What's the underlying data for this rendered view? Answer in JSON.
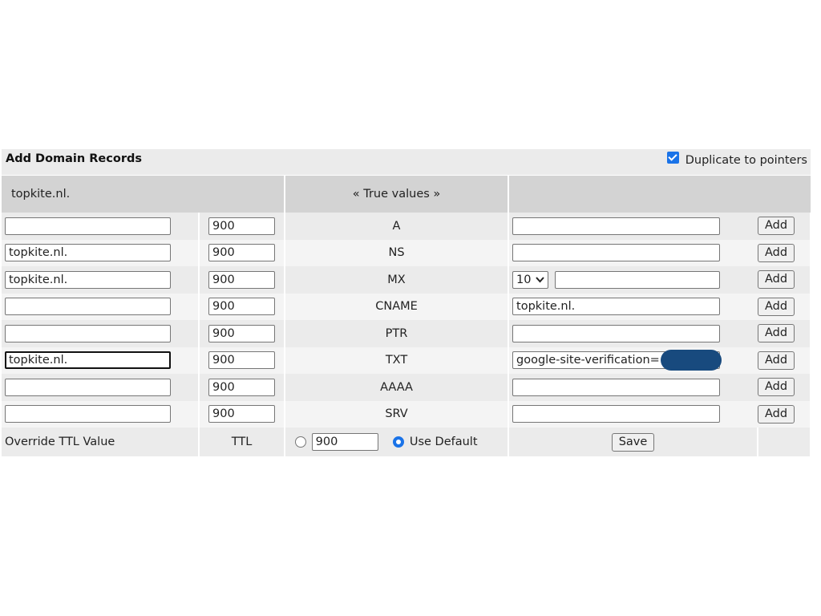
{
  "panel": {
    "title": "Add Domain Records",
    "duplicate_label": "Duplicate to pointers",
    "duplicate_checked": true
  },
  "header": {
    "domain": "topkite.nl.",
    "true_values": "« True values »"
  },
  "records": [
    {
      "name": "",
      "ttl": "900",
      "type": "A",
      "value": "",
      "add_label": "Add"
    },
    {
      "name": "topkite.nl.",
      "ttl": "900",
      "type": "NS",
      "value": "",
      "add_label": "Add"
    },
    {
      "name": "topkite.nl.",
      "ttl": "900",
      "type": "MX",
      "priority": "10",
      "value": "",
      "add_label": "Add"
    },
    {
      "name": "",
      "ttl": "900",
      "type": "CNAME",
      "value": "topkite.nl.",
      "add_label": "Add"
    },
    {
      "name": "",
      "ttl": "900",
      "type": "PTR",
      "value": "",
      "add_label": "Add"
    },
    {
      "name": "topkite.nl.",
      "ttl": "900",
      "type": "TXT",
      "value": "google-site-verification=",
      "add_label": "Add"
    },
    {
      "name": "",
      "ttl": "900",
      "type": "AAAA",
      "value": "",
      "add_label": "Add"
    },
    {
      "name": "",
      "ttl": "900",
      "type": "SRV",
      "value": "",
      "add_label": "Add"
    }
  ],
  "footer": {
    "override_label": "Override TTL Value",
    "ttl_label": "TTL",
    "ttl_value": "900",
    "use_default_label": "Use Default",
    "save_label": "Save"
  },
  "colors": {
    "accent": "#1a73e8",
    "redaction": "#184a7e"
  }
}
